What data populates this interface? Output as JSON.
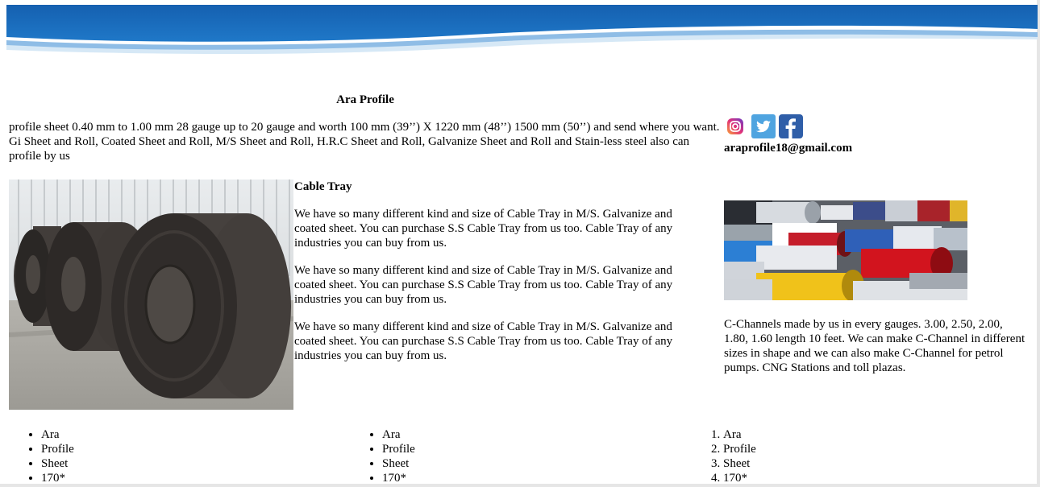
{
  "title": "Ara Profile",
  "intro": "profile sheet 0.40 mm to 1.00 mm 28 gauge up to 20 gauge and worth 100 mm (39’’) X 1220 mm (48’’) 1500 mm (50’’) and send where you want. Gi Sheet and Roll, Coated Sheet and Roll, M/S Sheet and Roll, H.R.C Sheet and Roll, Galvanize Sheet and Roll and Stain-less steel also can profile by us",
  "email": "araprofile18@gmail.com",
  "social": [
    {
      "name": "Instagram",
      "icon": "instagram-icon"
    },
    {
      "name": "Twitter",
      "icon": "twitter-icon"
    },
    {
      "name": "Facebook",
      "icon": "facebook-icon"
    }
  ],
  "section": {
    "heading": "Cable Tray",
    "paragraphs": [
      "We have so many different kind and size of Cable Tray in M/S. Galvanize and coated sheet. You can purchase S.S Cable Tray from us too. Cable Tray of any industries you can buy from us.",
      "We have so many different kind and size of Cable Tray in M/S. Galvanize and coated sheet. You can purchase S.S Cable Tray from us too. Cable Tray of any industries you can buy from us.",
      "We have so many different kind and size of Cable Tray in M/S. Galvanize and coated sheet. You can purchase S.S Cable Tray from us too. Cable Tray of any industries you can buy from us."
    ]
  },
  "right_text": "C-Channels made by us in every gauges. 3.00, 2.50, 2.00, 1.80, 1.60 length 10 feet. We can make C-Channel in different sizes in shape and we can also make C-Channel for petrol pumps. CNG Stations and toll plazas.",
  "lists": [
    {
      "type": "bullet",
      "items": [
        "Ara",
        "Profile",
        "Sheet",
        "170*"
      ]
    },
    {
      "type": "bullet",
      "items": [
        "Ara",
        "Profile",
        "Sheet",
        "170*"
      ]
    },
    {
      "type": "numbered",
      "items": [
        "Ara",
        "Profile",
        "Sheet",
        "170*"
      ]
    }
  ],
  "colors": {
    "header_blue": "#1a6fc0",
    "header_light": "#8fbde6",
    "twitter": "#4fa4e0",
    "facebook": "#2f5ea8"
  }
}
